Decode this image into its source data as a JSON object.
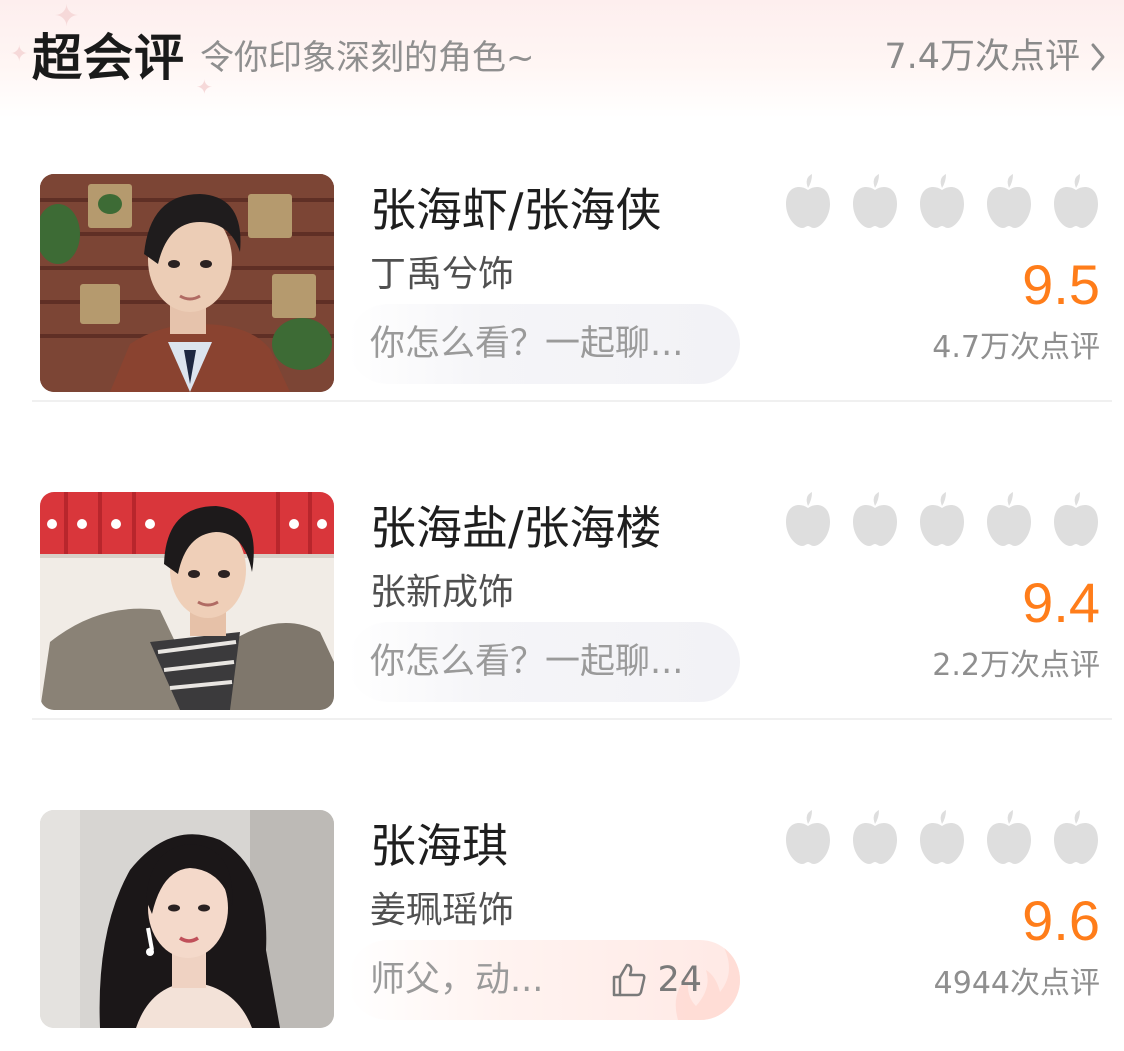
{
  "header": {
    "title": "超会评",
    "subtitle": "令你印象深刻的角色~",
    "total_reviews": "7.4万次点评"
  },
  "characters": [
    {
      "role": "张海虾/张海侠",
      "actor": "丁禹兮饰",
      "chat_prompt": "你怎么看？一起聊...",
      "score": "9.5",
      "review_count": "4.7万次点评",
      "apple_count": 5
    },
    {
      "role": "张海盐/张海楼",
      "actor": "张新成饰",
      "chat_prompt": "你怎么看？一起聊...",
      "score": "9.4",
      "review_count": "2.2万次点评",
      "apple_count": 5
    },
    {
      "role": "张海琪",
      "actor": "姜珮瑶饰",
      "chat_prompt": "师父，动...",
      "likes": "24",
      "score": "9.6",
      "review_count": "4944次点评",
      "apple_count": 5
    }
  ],
  "colors": {
    "score": "#ff7d1a",
    "apple_inactive": "#dedede",
    "header_bg": "#fdeeee"
  },
  "icons": {
    "rating": "apple-icon",
    "like": "thumbs-up-icon",
    "more": "chevron-right-icon"
  }
}
